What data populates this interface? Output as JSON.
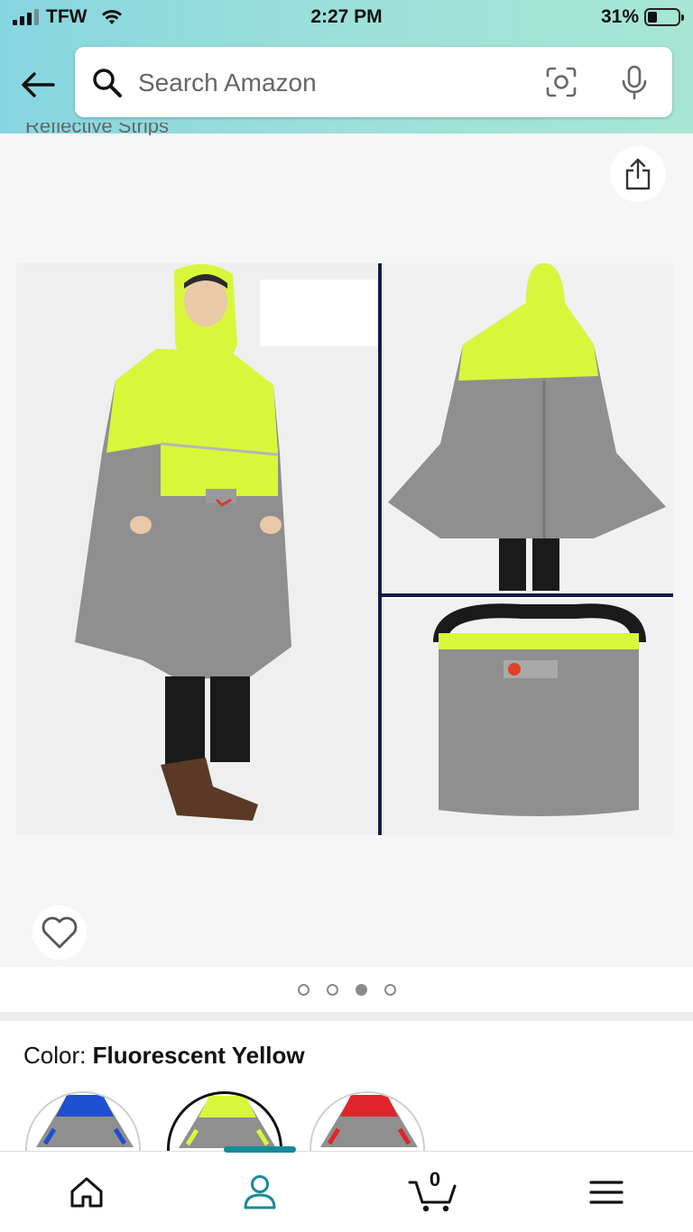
{
  "status_bar": {
    "carrier": "TFW",
    "time": "2:27 PM",
    "battery": "31%"
  },
  "search": {
    "placeholder": "Search Amazon"
  },
  "gallery": {
    "partial_text": "Reflective Strips",
    "page_count": 4,
    "active_index": 2
  },
  "color": {
    "label": "Color:",
    "value": "Fluorescent Yellow"
  },
  "swatches": [
    {
      "name": "Blue",
      "accent": "#1f4fd1"
    },
    {
      "name": "Fluorescent Yellow",
      "accent": "#d9f73a"
    },
    {
      "name": "Red",
      "accent": "#e1242a"
    }
  ],
  "cart": {
    "count": "0"
  },
  "colors": {
    "header_gradient": [
      "#86d6e0",
      "#a6e6d2"
    ],
    "accent": "#168b9a",
    "poncho_yellow": "#d9f73a",
    "poncho_gray": "#8f8f8f"
  },
  "icons": [
    "back-arrow",
    "search",
    "camera-scan",
    "microphone",
    "share",
    "heart",
    "home",
    "user",
    "cart",
    "menu"
  ]
}
